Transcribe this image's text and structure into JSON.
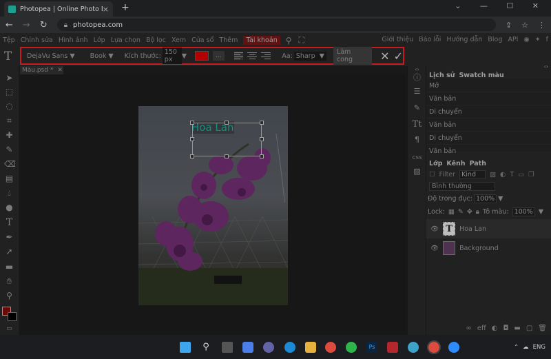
{
  "browser": {
    "tab_title": "Photopea | Online Photo Editor",
    "tab_close": "×",
    "new_tab": "+",
    "url": "photopea.com"
  },
  "menu": {
    "items": [
      "Tệp",
      "Chỉnh sửa",
      "Hình ảnh",
      "Lớp",
      "Lựa chọn",
      "Bộ lọc",
      "Xem",
      "Cửa sổ",
      "Thêm",
      "Tài khoản"
    ],
    "right_items": [
      "Giới thiệu",
      "Báo lỗi",
      "Hướng dẫn",
      "Blog",
      "API"
    ]
  },
  "options": {
    "font_family": "DejaVu Sans ▼",
    "font_style": "Book ▼",
    "size_label": "Kích thước:",
    "size_value": "150 px",
    "size_arrow": "▼",
    "more_btn": "...",
    "aa_label": "Aa:",
    "aa_value": "Sharp",
    "aa_arrow": "▼",
    "warp_btn": "Làm cong",
    "text_color": "#cc0000"
  },
  "document": {
    "tab_name": "Màu.psd *",
    "tab_close": "✕",
    "text_content": "Hoa Lan",
    "text_color": "#1aa38f"
  },
  "history": {
    "tabs": [
      "Lịch sử",
      "Swatch màu"
    ],
    "rows": [
      "Mở",
      "Văn bản",
      "Di chuyển",
      "Văn bản",
      "Di chuyển",
      "Văn bản"
    ]
  },
  "layers": {
    "tabs": [
      "Lớp",
      "Kênh",
      "Path"
    ],
    "filter_label": "Filter",
    "filter_kind": "Kind",
    "blend_mode": "Bình thường",
    "opacity_label": "Độ trong đục:",
    "opacity_value": "100%",
    "lock_label": "Lock:",
    "fill_label": "Tô màu:",
    "fill_value": "100%",
    "items": [
      {
        "name": "Hoa Lan",
        "thumb": "T"
      },
      {
        "name": "Background",
        "thumb": ""
      }
    ],
    "bottom_labels": [
      "eff"
    ]
  },
  "panel_icons": [
    "CSS"
  ],
  "tray": {
    "lang": "ENG"
  },
  "colors": {
    "accent_red": "#e21f26",
    "active_menu": "#6f1515"
  }
}
